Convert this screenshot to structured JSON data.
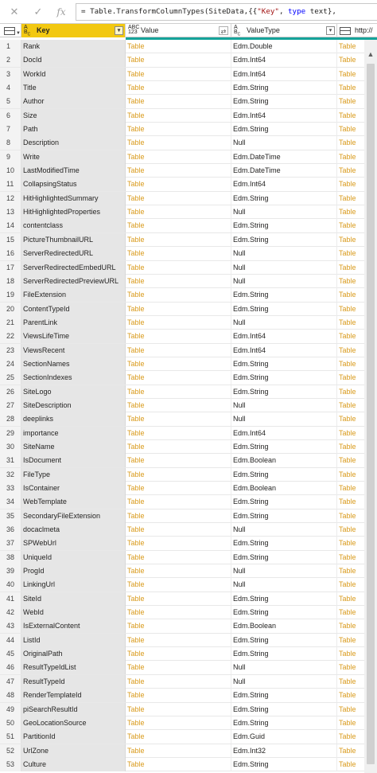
{
  "formula_bar": {
    "formula_prefix": "= Table.TransformColumnTypes(SiteData,{{",
    "formula_string": "\"Key\"",
    "formula_sep": ", ",
    "formula_keyword": "type",
    "formula_suffix": " text},"
  },
  "columns": {
    "key": "Key",
    "value": "Value",
    "valuetype": "ValueType",
    "http": "http://"
  },
  "rows": [
    {
      "n": "1",
      "key": "Rank",
      "value": "Table",
      "type": "Edm.Double",
      "http": "Table"
    },
    {
      "n": "2",
      "key": "DocId",
      "value": "Table",
      "type": "Edm.Int64",
      "http": "Table"
    },
    {
      "n": "3",
      "key": "WorkId",
      "value": "Table",
      "type": "Edm.Int64",
      "http": "Table"
    },
    {
      "n": "4",
      "key": "Title",
      "value": "Table",
      "type": "Edm.String",
      "http": "Table"
    },
    {
      "n": "5",
      "key": "Author",
      "value": "Table",
      "type": "Edm.String",
      "http": "Table"
    },
    {
      "n": "6",
      "key": "Size",
      "value": "Table",
      "type": "Edm.Int64",
      "http": "Table"
    },
    {
      "n": "7",
      "key": "Path",
      "value": "Table",
      "type": "Edm.String",
      "http": "Table"
    },
    {
      "n": "8",
      "key": "Description",
      "value": "Table",
      "type": "Null",
      "http": "Table"
    },
    {
      "n": "9",
      "key": "Write",
      "value": "Table",
      "type": "Edm.DateTime",
      "http": "Table"
    },
    {
      "n": "10",
      "key": "LastModifiedTime",
      "value": "Table",
      "type": "Edm.DateTime",
      "http": "Table"
    },
    {
      "n": "11",
      "key": "CollapsingStatus",
      "value": "Table",
      "type": "Edm.Int64",
      "http": "Table"
    },
    {
      "n": "12",
      "key": "HitHighlightedSummary",
      "value": "Table",
      "type": "Edm.String",
      "http": "Table"
    },
    {
      "n": "13",
      "key": "HitHighlightedProperties",
      "value": "Table",
      "type": "Null",
      "http": "Table"
    },
    {
      "n": "14",
      "key": "contentclass",
      "value": "Table",
      "type": "Edm.String",
      "http": "Table"
    },
    {
      "n": "15",
      "key": "PictureThumbnailURL",
      "value": "Table",
      "type": "Edm.String",
      "http": "Table"
    },
    {
      "n": "16",
      "key": "ServerRedirectedURL",
      "value": "Table",
      "type": "Null",
      "http": "Table"
    },
    {
      "n": "17",
      "key": "ServerRedirectedEmbedURL",
      "value": "Table",
      "type": "Null",
      "http": "Table"
    },
    {
      "n": "18",
      "key": "ServerRedirectedPreviewURL",
      "value": "Table",
      "type": "Null",
      "http": "Table"
    },
    {
      "n": "19",
      "key": "FileExtension",
      "value": "Table",
      "type": "Edm.String",
      "http": "Table"
    },
    {
      "n": "20",
      "key": "ContentTypeId",
      "value": "Table",
      "type": "Edm.String",
      "http": "Table"
    },
    {
      "n": "21",
      "key": "ParentLink",
      "value": "Table",
      "type": "Null",
      "http": "Table"
    },
    {
      "n": "22",
      "key": "ViewsLifeTime",
      "value": "Table",
      "type": "Edm.Int64",
      "http": "Table"
    },
    {
      "n": "23",
      "key": "ViewsRecent",
      "value": "Table",
      "type": "Edm.Int64",
      "http": "Table"
    },
    {
      "n": "24",
      "key": "SectionNames",
      "value": "Table",
      "type": "Edm.String",
      "http": "Table"
    },
    {
      "n": "25",
      "key": "SectionIndexes",
      "value": "Table",
      "type": "Edm.String",
      "http": "Table"
    },
    {
      "n": "26",
      "key": "SiteLogo",
      "value": "Table",
      "type": "Edm.String",
      "http": "Table"
    },
    {
      "n": "27",
      "key": "SiteDescription",
      "value": "Table",
      "type": "Null",
      "http": "Table"
    },
    {
      "n": "28",
      "key": "deeplinks",
      "value": "Table",
      "type": "Null",
      "http": "Table"
    },
    {
      "n": "29",
      "key": "importance",
      "value": "Table",
      "type": "Edm.Int64",
      "http": "Table"
    },
    {
      "n": "30",
      "key": "SiteName",
      "value": "Table",
      "type": "Edm.String",
      "http": "Table"
    },
    {
      "n": "31",
      "key": "IsDocument",
      "value": "Table",
      "type": "Edm.Boolean",
      "http": "Table"
    },
    {
      "n": "32",
      "key": "FileType",
      "value": "Table",
      "type": "Edm.String",
      "http": "Table"
    },
    {
      "n": "33",
      "key": "IsContainer",
      "value": "Table",
      "type": "Edm.Boolean",
      "http": "Table"
    },
    {
      "n": "34",
      "key": "WebTemplate",
      "value": "Table",
      "type": "Edm.String",
      "http": "Table"
    },
    {
      "n": "35",
      "key": "SecondaryFileExtension",
      "value": "Table",
      "type": "Edm.String",
      "http": "Table"
    },
    {
      "n": "36",
      "key": "docaclmeta",
      "value": "Table",
      "type": "Null",
      "http": "Table"
    },
    {
      "n": "37",
      "key": "SPWebUrl",
      "value": "Table",
      "type": "Edm.String",
      "http": "Table"
    },
    {
      "n": "38",
      "key": "UniqueId",
      "value": "Table",
      "type": "Edm.String",
      "http": "Table"
    },
    {
      "n": "39",
      "key": "ProgId",
      "value": "Table",
      "type": "Null",
      "http": "Table"
    },
    {
      "n": "40",
      "key": "LinkingUrl",
      "value": "Table",
      "type": "Null",
      "http": "Table"
    },
    {
      "n": "41",
      "key": "SiteId",
      "value": "Table",
      "type": "Edm.String",
      "http": "Table"
    },
    {
      "n": "42",
      "key": "WebId",
      "value": "Table",
      "type": "Edm.String",
      "http": "Table"
    },
    {
      "n": "43",
      "key": "IsExternalContent",
      "value": "Table",
      "type": "Edm.Boolean",
      "http": "Table"
    },
    {
      "n": "44",
      "key": "ListId",
      "value": "Table",
      "type": "Edm.String",
      "http": "Table"
    },
    {
      "n": "45",
      "key": "OriginalPath",
      "value": "Table",
      "type": "Edm.String",
      "http": "Table"
    },
    {
      "n": "46",
      "key": "ResultTypeIdList",
      "value": "Table",
      "type": "Null",
      "http": "Table"
    },
    {
      "n": "47",
      "key": "ResultTypeId",
      "value": "Table",
      "type": "Null",
      "http": "Table"
    },
    {
      "n": "48",
      "key": "RenderTemplateId",
      "value": "Table",
      "type": "Edm.String",
      "http": "Table"
    },
    {
      "n": "49",
      "key": "piSearchResultId",
      "value": "Table",
      "type": "Edm.String",
      "http": "Table"
    },
    {
      "n": "50",
      "key": "GeoLocationSource",
      "value": "Table",
      "type": "Edm.String",
      "http": "Table"
    },
    {
      "n": "51",
      "key": "PartitionId",
      "value": "Table",
      "type": "Edm.Guid",
      "http": "Table"
    },
    {
      "n": "52",
      "key": "UrlZone",
      "value": "Table",
      "type": "Edm.Int32",
      "http": "Table"
    },
    {
      "n": "53",
      "key": "Culture",
      "value": "Table",
      "type": "Edm.String",
      "http": "Table"
    }
  ]
}
